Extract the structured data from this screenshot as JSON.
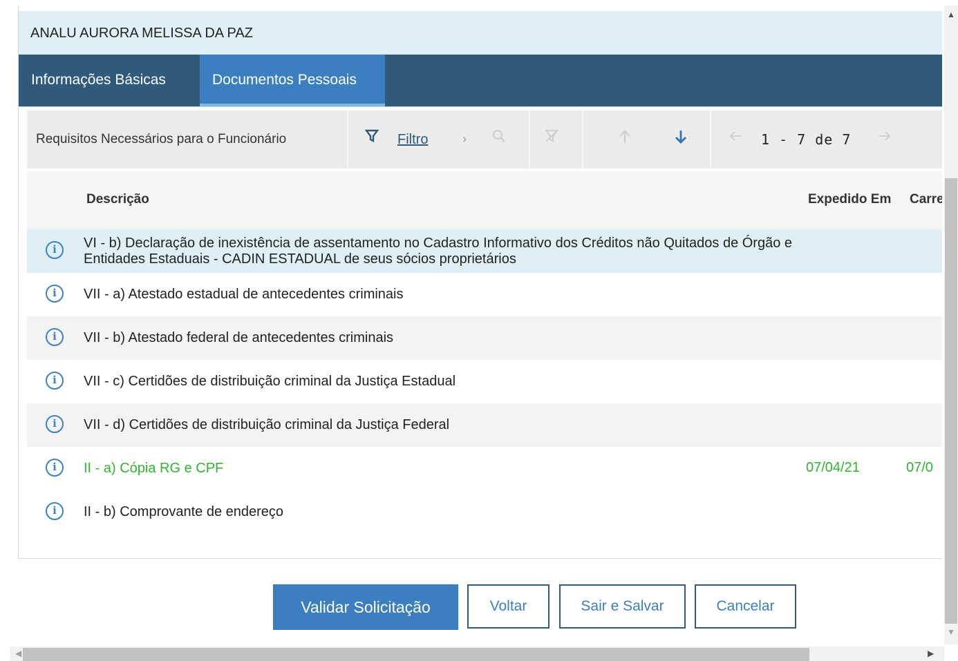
{
  "employee_name": "ANALU AURORA MELISSA DA PAZ",
  "tabs": [
    {
      "label": "Informações Básicas",
      "active": false
    },
    {
      "label": "Documentos Pessoais",
      "active": true
    }
  ],
  "toolbar": {
    "title": "Requisitos Necessários para o Funcionário",
    "filter_label": "Filtro",
    "pager": "1 - 7 de 7",
    "icons": [
      "filter-icon",
      "chevron-right-icon",
      "search-icon",
      "clear-filter-icon",
      "arrow-up-icon",
      "arrow-down-icon",
      "arrow-left-icon",
      "arrow-right-icon"
    ]
  },
  "columns": {
    "descricao": "Descrição",
    "expedido_em": "Expedido Em",
    "carregado": "Carre"
  },
  "rows": [
    {
      "descricao": "VI - b) Declaração de inexistência de assentamento no Cadastro Informativo dos Créditos não Quitados de Órgão e Entidades Estaduais - CADIN ESTADUAL de seus sócios proprietários",
      "expedido_em": "",
      "carregado": ""
    },
    {
      "descricao": "VII - a) Atestado estadual de antecedentes criminais",
      "expedido_em": "",
      "carregado": ""
    },
    {
      "descricao": "VII - b) Atestado federal de antecedentes criminais",
      "expedido_em": "",
      "carregado": ""
    },
    {
      "descricao": "VII - c) Certidões de distribuição criminal da Justiça Estadual",
      "expedido_em": "",
      "carregado": ""
    },
    {
      "descricao": "VII - d) Certidões de distribuição criminal da Justiça Federal",
      "expedido_em": "",
      "carregado": ""
    },
    {
      "descricao": "II - a) Cópia RG e CPF",
      "expedido_em": "07/04/21",
      "carregado": "07/0",
      "status": "completed"
    },
    {
      "descricao": "II - b) Comprovante de endereço",
      "expedido_em": "",
      "carregado": ""
    }
  ],
  "buttons": {
    "validar": "Validar Solicitação",
    "voltar": "Voltar",
    "sair_salvar": "Sair e Salvar",
    "cancelar": "Cancelar"
  },
  "colors": {
    "tab_bar": "#2f5a7c",
    "active_tab": "#3c7fc0",
    "name_bar": "#dff0f8",
    "completed_row_text": "#2fb52f",
    "info_icon": "#3b82c4"
  }
}
